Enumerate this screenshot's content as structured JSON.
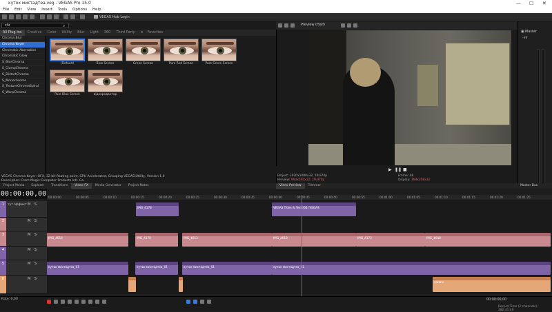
{
  "window": {
    "title": "кутох мистадтеа.veg - VEGAS Pro 15.0"
  },
  "menu": [
    "File",
    "Edit",
    "View",
    "Insert",
    "Tools",
    "Options",
    "Help"
  ],
  "toolbar": {
    "hub_label": "VEGAS Hub Login"
  },
  "fx": {
    "search_value": "chr",
    "tabs": [
      "All Plug-ins",
      "Creative",
      "Color",
      "Utility",
      "Blur",
      "Light",
      "360",
      "Third Party",
      "Favorites"
    ],
    "plugins": [
      "Chroma Blur",
      "Chroma Keyer",
      "Chromatic Aberration",
      "Chromatic Glow",
      "S_BlurChroma",
      "S_ClampChroma",
      "S_DistortChroma",
      "S_Monochrome",
      "S_TextureChromaSpiral",
      "S_WarpChroma"
    ],
    "selected_plugin": "Chroma Keyer",
    "presets": [
      "(Default)",
      "Blue Screen",
      "Green Screen",
      "Pure Red Screen",
      "Pure Green Screen",
      "Pure Blue Screen",
      "відеоредактор"
    ],
    "description_1": "VEGAS Chroma Keyer: OFX, 32-bit floating point, GPU Accelerated, Grouping VEGAS\\Utility, Version 1.0",
    "description_2": "Description: From Magix Computer Products Intl. Co."
  },
  "left_tabs": [
    "Project Media",
    "Explorer",
    "Transitions",
    "Video FX",
    "Media Generator",
    "Project Notes"
  ],
  "preview": {
    "mode": "Preview (Half)",
    "project": "Project:   1920x1080x32; 29,970p",
    "preview_label": "Preview:",
    "preview_value": "960x540x32; 29,970p",
    "frame": "Frame:   48",
    "display_label": "Display:",
    "display_value": "369x208x32",
    "tabs": [
      "Video Preview",
      "Trimmer"
    ]
  },
  "master": {
    "label": "Master",
    "bus_label": "Master Bus",
    "value": "-Inf",
    "zero_label": "0.0"
  },
  "timeline": {
    "timecode": "00:00:00,00",
    "ruler": [
      "00:00:00",
      "00:00:05",
      "00:00:10",
      "00:00:15",
      "00:00:20",
      "00:00:25",
      "00:00:30",
      "00:00:35",
      "00:00:40",
      "00:00:45",
      "00:00:50",
      "00:00:55",
      "00:01:00",
      "00:01:05",
      "00:01:10",
      "00:01:15",
      "00:01:20",
      "00:01:25",
      "00:01:30"
    ],
    "tracks": [
      {
        "num": "1",
        "name": "тут эффект"
      },
      {
        "num": "2",
        "name": ""
      },
      {
        "num": "3",
        "name": ""
      },
      {
        "num": "4",
        "name": ""
      },
      {
        "num": "5",
        "name": ""
      },
      {
        "num": "6",
        "name": ""
      }
    ],
    "events": {
      "e1": "IMG_4178",
      "e2": "VEGAS Titles & Text [66] VEGAS",
      "e3": "VEGAS Titles & Text",
      "e4": "IMG_4018",
      "e5": "IMG_4178",
      "e6": "IMG_4013",
      "e7": "IMG_4018",
      "e8": "IMG_4173",
      "e9": "IMG_4648",
      "e10": "кутох мистадтеа_01",
      "e11": "кутох мистадтеа_01",
      "e12": "кутох мистадтеа_01",
      "e13": "кутох мистадтеа_01",
      "e14": "corona"
    }
  },
  "bottom": {
    "rate": "Rate: 0,00",
    "timecode": "00:00:00,00",
    "record_time": "Record Time (2 channels): 282:41:49"
  }
}
